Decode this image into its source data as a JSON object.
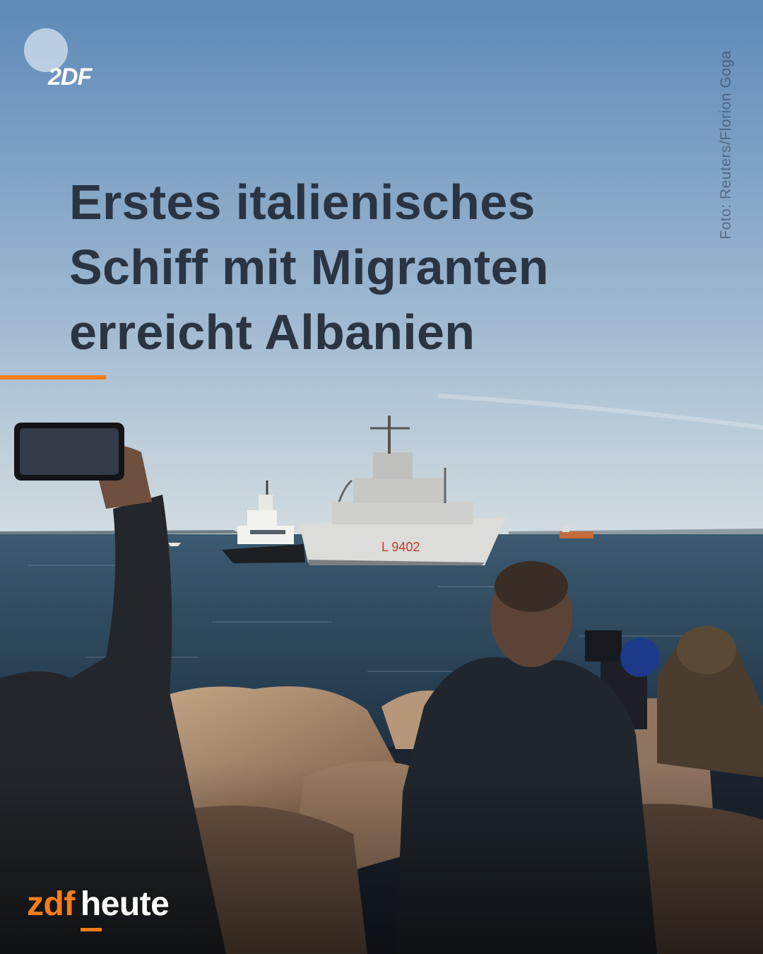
{
  "headline": {
    "lines": [
      "Erstes italienisches",
      "Schiff mit Migranten",
      "erreicht Albanien"
    ]
  },
  "badge": {
    "text": "2DF"
  },
  "credit": {
    "text": "Foto: Reuters/Florion Goga"
  },
  "brand": {
    "part1": "zdf",
    "part2": "heute"
  },
  "ship": {
    "hull_number": "L 9402"
  },
  "colors": {
    "accent": "#fa7d19",
    "headline": "#2a3442",
    "sky_top": "#5d89b8",
    "sky_horizon": "#cfd9df",
    "sea": "#2d4a5f"
  }
}
